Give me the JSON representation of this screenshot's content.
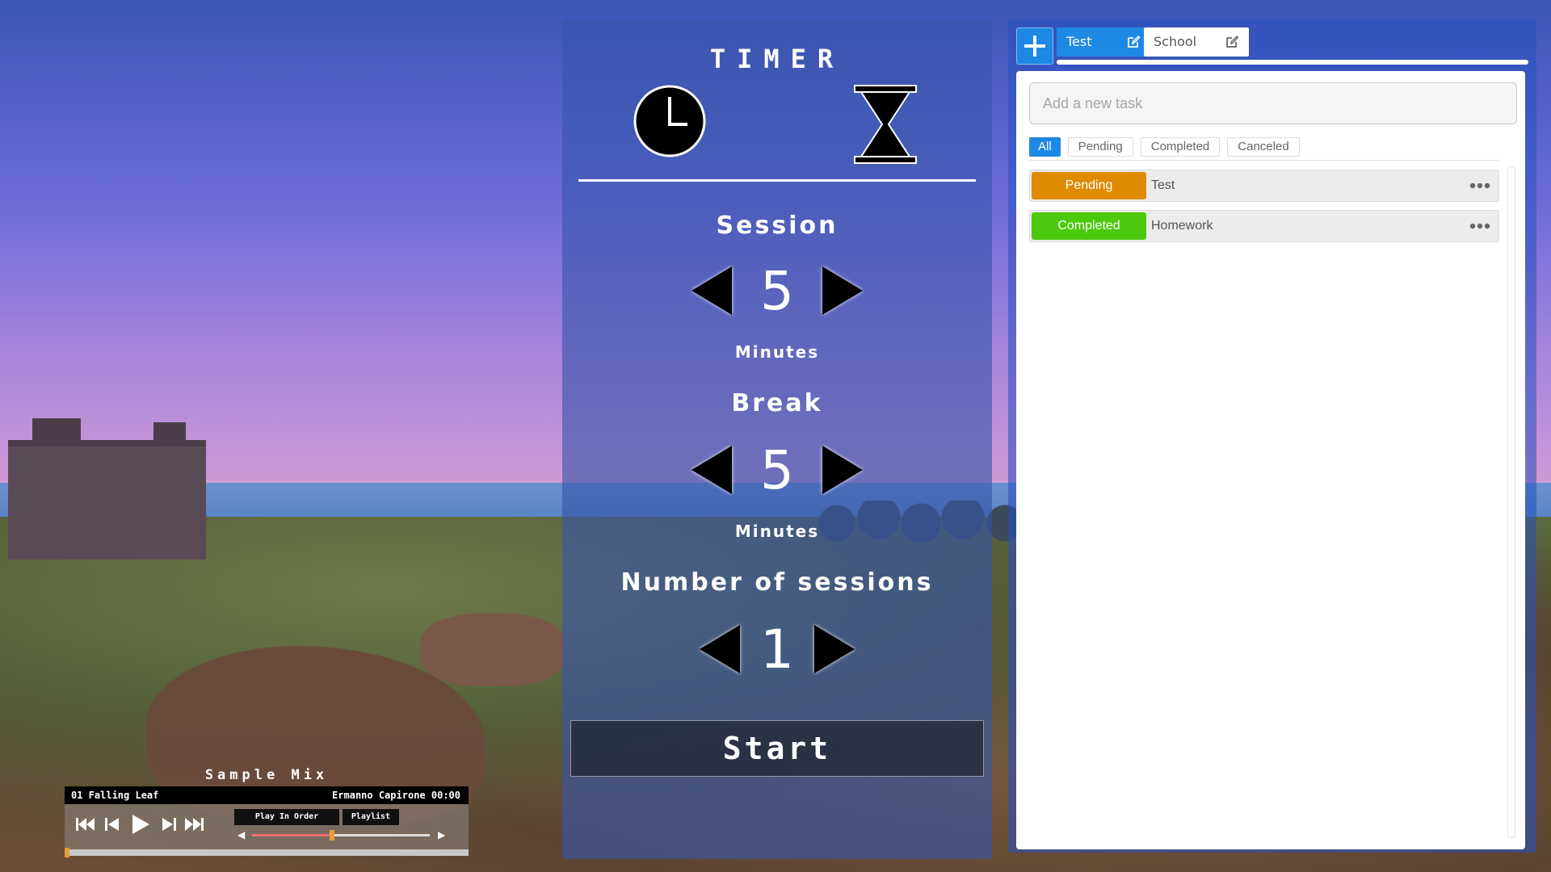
{
  "timer": {
    "title": "TIMER",
    "session_label": "Session",
    "session_value": "5",
    "session_units": "Minutes",
    "break_label": "Break",
    "break_value": "5",
    "break_units": "Minutes",
    "sessions_label": "Number of sessions",
    "sessions_value": "1",
    "start_label": "Start"
  },
  "tasks": {
    "lists": [
      {
        "name": "Test",
        "active": true
      },
      {
        "name": "School",
        "active": false
      }
    ],
    "input_placeholder": "Add a new task",
    "filters": [
      "All",
      "Pending",
      "Completed",
      "Canceled"
    ],
    "active_filter": "All",
    "items": [
      {
        "status": "Pending",
        "name": "Test",
        "color": "#e08a00"
      },
      {
        "status": "Completed",
        "name": "Homework",
        "color": "#4cc90c"
      }
    ]
  },
  "player": {
    "mix_title": "Sample Mix",
    "track": "01 Falling Leaf",
    "artist_time": "Ermanno Capirone  00:00",
    "play_order_label": "Play In Order",
    "playlist_label": "Playlist",
    "volume_fraction": 0.45,
    "progress_fraction": 0.0
  },
  "colors": {
    "accent": "#1e88e5",
    "pending": "#e08a00",
    "completed": "#4cc90c"
  }
}
